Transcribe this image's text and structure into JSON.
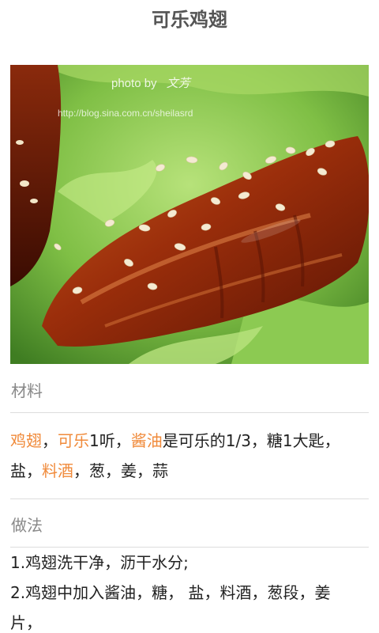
{
  "header": {
    "title": "可乐鸡翅"
  },
  "photo": {
    "watermark_line1": "photo by",
    "watermark_author": "文芳",
    "watermark_line2": "http://blog.sina.com.cn/sheilasrd"
  },
  "ingredients": {
    "label": "材料",
    "line1": [
      {
        "text": "鸡翅",
        "link": true
      },
      {
        "text": "，",
        "link": false
      },
      {
        "text": "可乐",
        "link": true
      },
      {
        "text": "1听，",
        "link": false
      },
      {
        "text": "酱油",
        "link": true
      },
      {
        "text": "是可乐的1/3，糖1大匙，",
        "link": false
      }
    ],
    "line2": [
      {
        "text": "盐，",
        "link": false
      },
      {
        "text": "料酒",
        "link": true
      },
      {
        "text": "，葱，姜，蒜",
        "link": false
      }
    ]
  },
  "method": {
    "label": "做法",
    "steps": [
      "1.鸡翅洗干净，沥干水分;",
      "2.鸡翅中加入酱油，糖，  盐，料酒，葱段，姜",
      "片，"
    ]
  },
  "colors": {
    "highlight": "#f08a3a",
    "title": "#555555",
    "label": "#888888"
  }
}
